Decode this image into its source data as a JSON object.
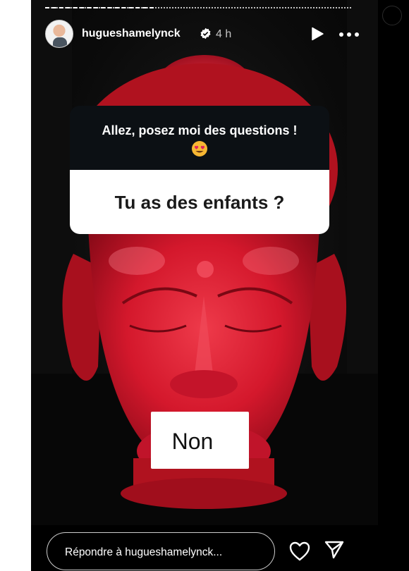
{
  "header": {
    "username": "hugueshamelynck",
    "time_ago": "4 h"
  },
  "sticker": {
    "prompt": "Allez, posez moi des questions !",
    "question": "Tu as des enfants ?"
  },
  "answer": {
    "text": "Non"
  },
  "footer": {
    "reply_placeholder": "Répondre à hugueshamelynck..."
  },
  "progress": {
    "segments": 2,
    "current_fraction": 0.35
  },
  "colors": {
    "story_background": "#000000",
    "sticker_dark": "#0c1014",
    "sticker_light": "#ffffff",
    "buddha_red": "#d4182c"
  },
  "icons": [
    "avatar",
    "verified-icon",
    "play-icon",
    "more-icon",
    "heart-eyes-emoji",
    "heart-icon",
    "send-icon"
  ]
}
